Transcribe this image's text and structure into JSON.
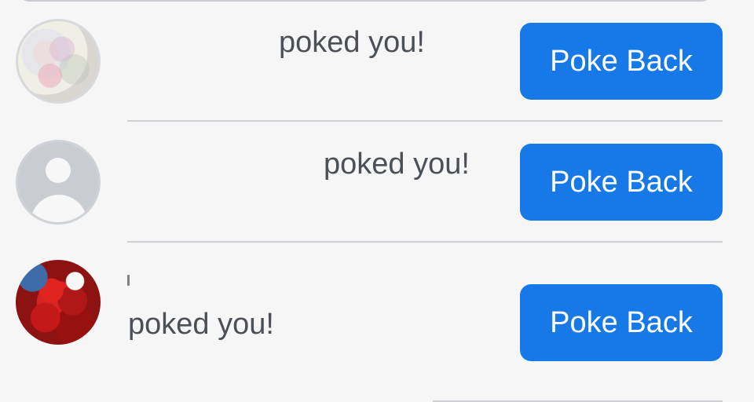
{
  "notifications": [
    {
      "message": "poked you!",
      "button_label": "Poke Back",
      "avatar_icon": "profile-photo-icon"
    },
    {
      "message": "poked you!",
      "button_label": "Poke Back",
      "avatar_icon": "default-user-icon"
    },
    {
      "message": "poked you!",
      "button_label": "Poke Back",
      "avatar_icon": "profile-photo-icon"
    }
  ],
  "colors": {
    "button": "#1778e8",
    "text": "#4b4f56",
    "divider": "#cfd1d6",
    "background": "#f6f6f6"
  }
}
